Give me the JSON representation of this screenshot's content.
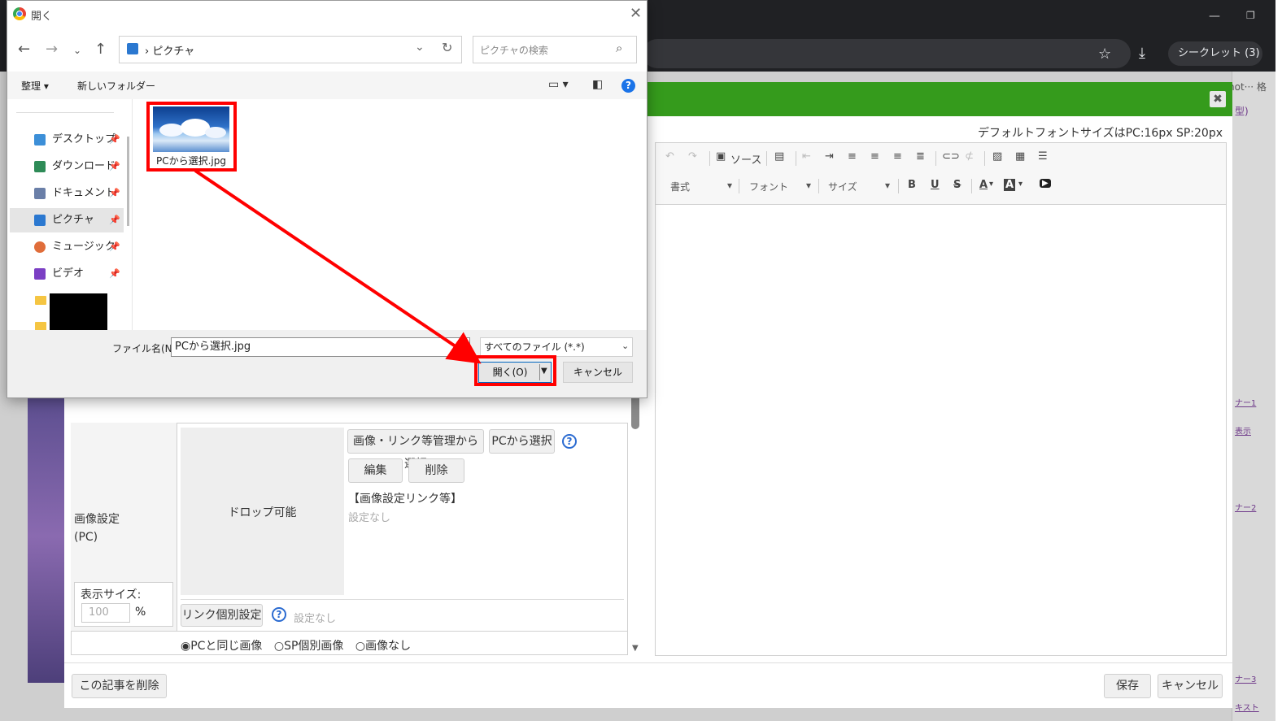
{
  "browser": {
    "incognito_label": "シークレット (3)",
    "star_icon": "star-icon",
    "download_icon": "download-icon",
    "partial_tab_text": "not··· 格"
  },
  "dialog": {
    "title": "開く",
    "address": {
      "path": "ピクチャ",
      "search_placeholder": "ピクチャの検索"
    },
    "toolbar": {
      "organize": "整理 ▾",
      "new_folder": "新しいフォルダー"
    },
    "nav_items": [
      {
        "label": "デスクトップ",
        "color": "#3c8fd8"
      },
      {
        "label": "ダウンロード",
        "color": "#2e8b57"
      },
      {
        "label": "ドキュメント",
        "color": "#6a7fa8"
      },
      {
        "label": "ピクチャ",
        "color": "#2b78d0"
      },
      {
        "label": "ミュージック",
        "color": "#e06d3a"
      },
      {
        "label": "ビデオ",
        "color": "#7b3fc4"
      }
    ],
    "file": {
      "name": "PCから選択.jpg"
    },
    "filename_label": "ファイル名(N):",
    "filename_value": "PCから選択.jpg",
    "filetype_value": "すべてのファイル (*.*)",
    "open_label": "開く(O)",
    "cancel_label": "キャンセル"
  },
  "editor": {
    "font_note": "デフォルトフォントサイズはPC:16px SP:20px",
    "toolbar": {
      "source": "ソース",
      "format": "書式",
      "font": "フォント",
      "size": "サイズ",
      "bold": "B",
      "underline": "U",
      "strike": "S",
      "text_color": "A",
      "bg_color": "A"
    }
  },
  "form": {
    "image_label_1": "画像設定",
    "image_label_2": "(PC)",
    "drop_label": "ドロップ可能",
    "select_manage": "画像・リンク等管理から選択",
    "select_pc": "PCから選択",
    "edit": "編集",
    "delete": "削除",
    "link_title": "【画像設定リンク等】",
    "link_value": "設定なし",
    "size_label": "表示サイズ:",
    "size_value": "100",
    "size_unit": "%",
    "link_individual": "リンク個別設定",
    "link_individual_value": "設定なし",
    "sp_same": "◉PCと同じ画像",
    "sp_individual": "○SP個別画像",
    "sp_none": "○画像なし"
  },
  "footer": {
    "delete_article": "この記事を削除",
    "save": "保存",
    "cancel": "キャンセル"
  },
  "side_links": [
    "ナー1",
    "表示",
    "ナー2",
    "ナー3",
    "キスト"
  ],
  "side_top": "型)"
}
